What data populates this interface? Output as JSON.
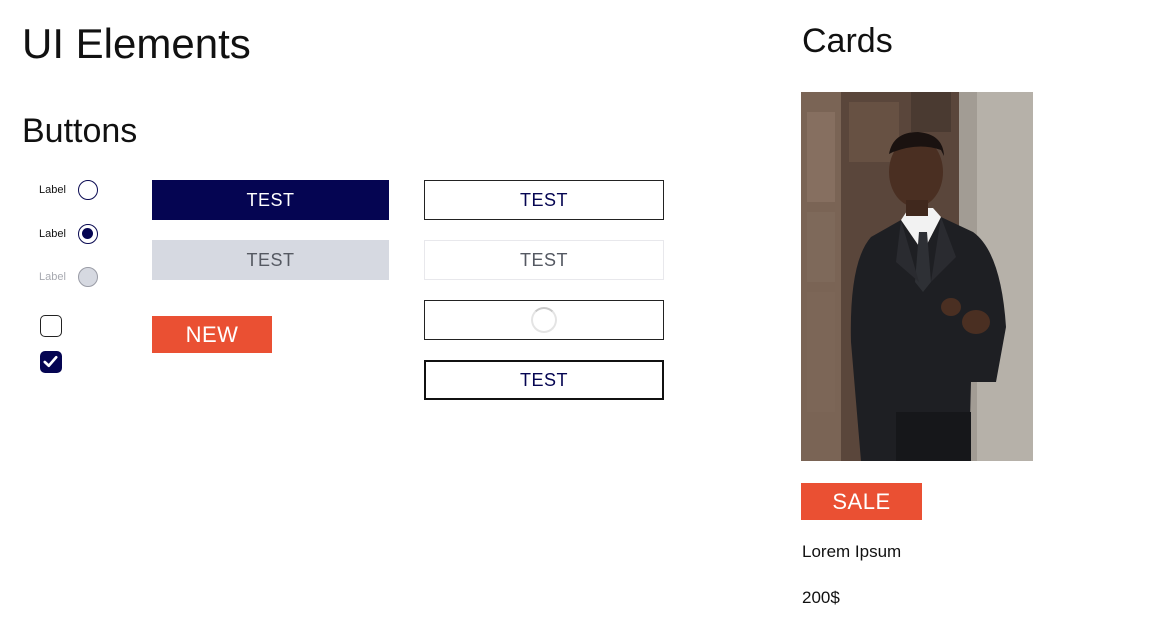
{
  "page": {
    "title": "UI Elements"
  },
  "buttons_section": {
    "title": "Buttons"
  },
  "radios": [
    {
      "label": "Label",
      "state": "unchecked"
    },
    {
      "label": "Label",
      "state": "checked"
    },
    {
      "label": "Label",
      "state": "disabled"
    }
  ],
  "checkboxes": [
    {
      "state": "unchecked"
    },
    {
      "state": "checked",
      "icon": "checkmark-icon"
    }
  ],
  "filled_buttons": {
    "primary": "TEST",
    "disabled": "TEST",
    "new_tag": "NEW"
  },
  "outline_buttons": {
    "default": "TEST",
    "disabled": "TEST",
    "loading_icon": "spinner-icon",
    "bold": "TEST"
  },
  "cards_section": {
    "title": "Cards",
    "card": {
      "image": "product-photo-man-in-suit",
      "tag": "SALE",
      "name": "Lorem Ipsum",
      "price": "200$"
    }
  },
  "colors": {
    "navy": "#050552",
    "accent": "#ea5033",
    "disabled": "#d6d9e1"
  }
}
